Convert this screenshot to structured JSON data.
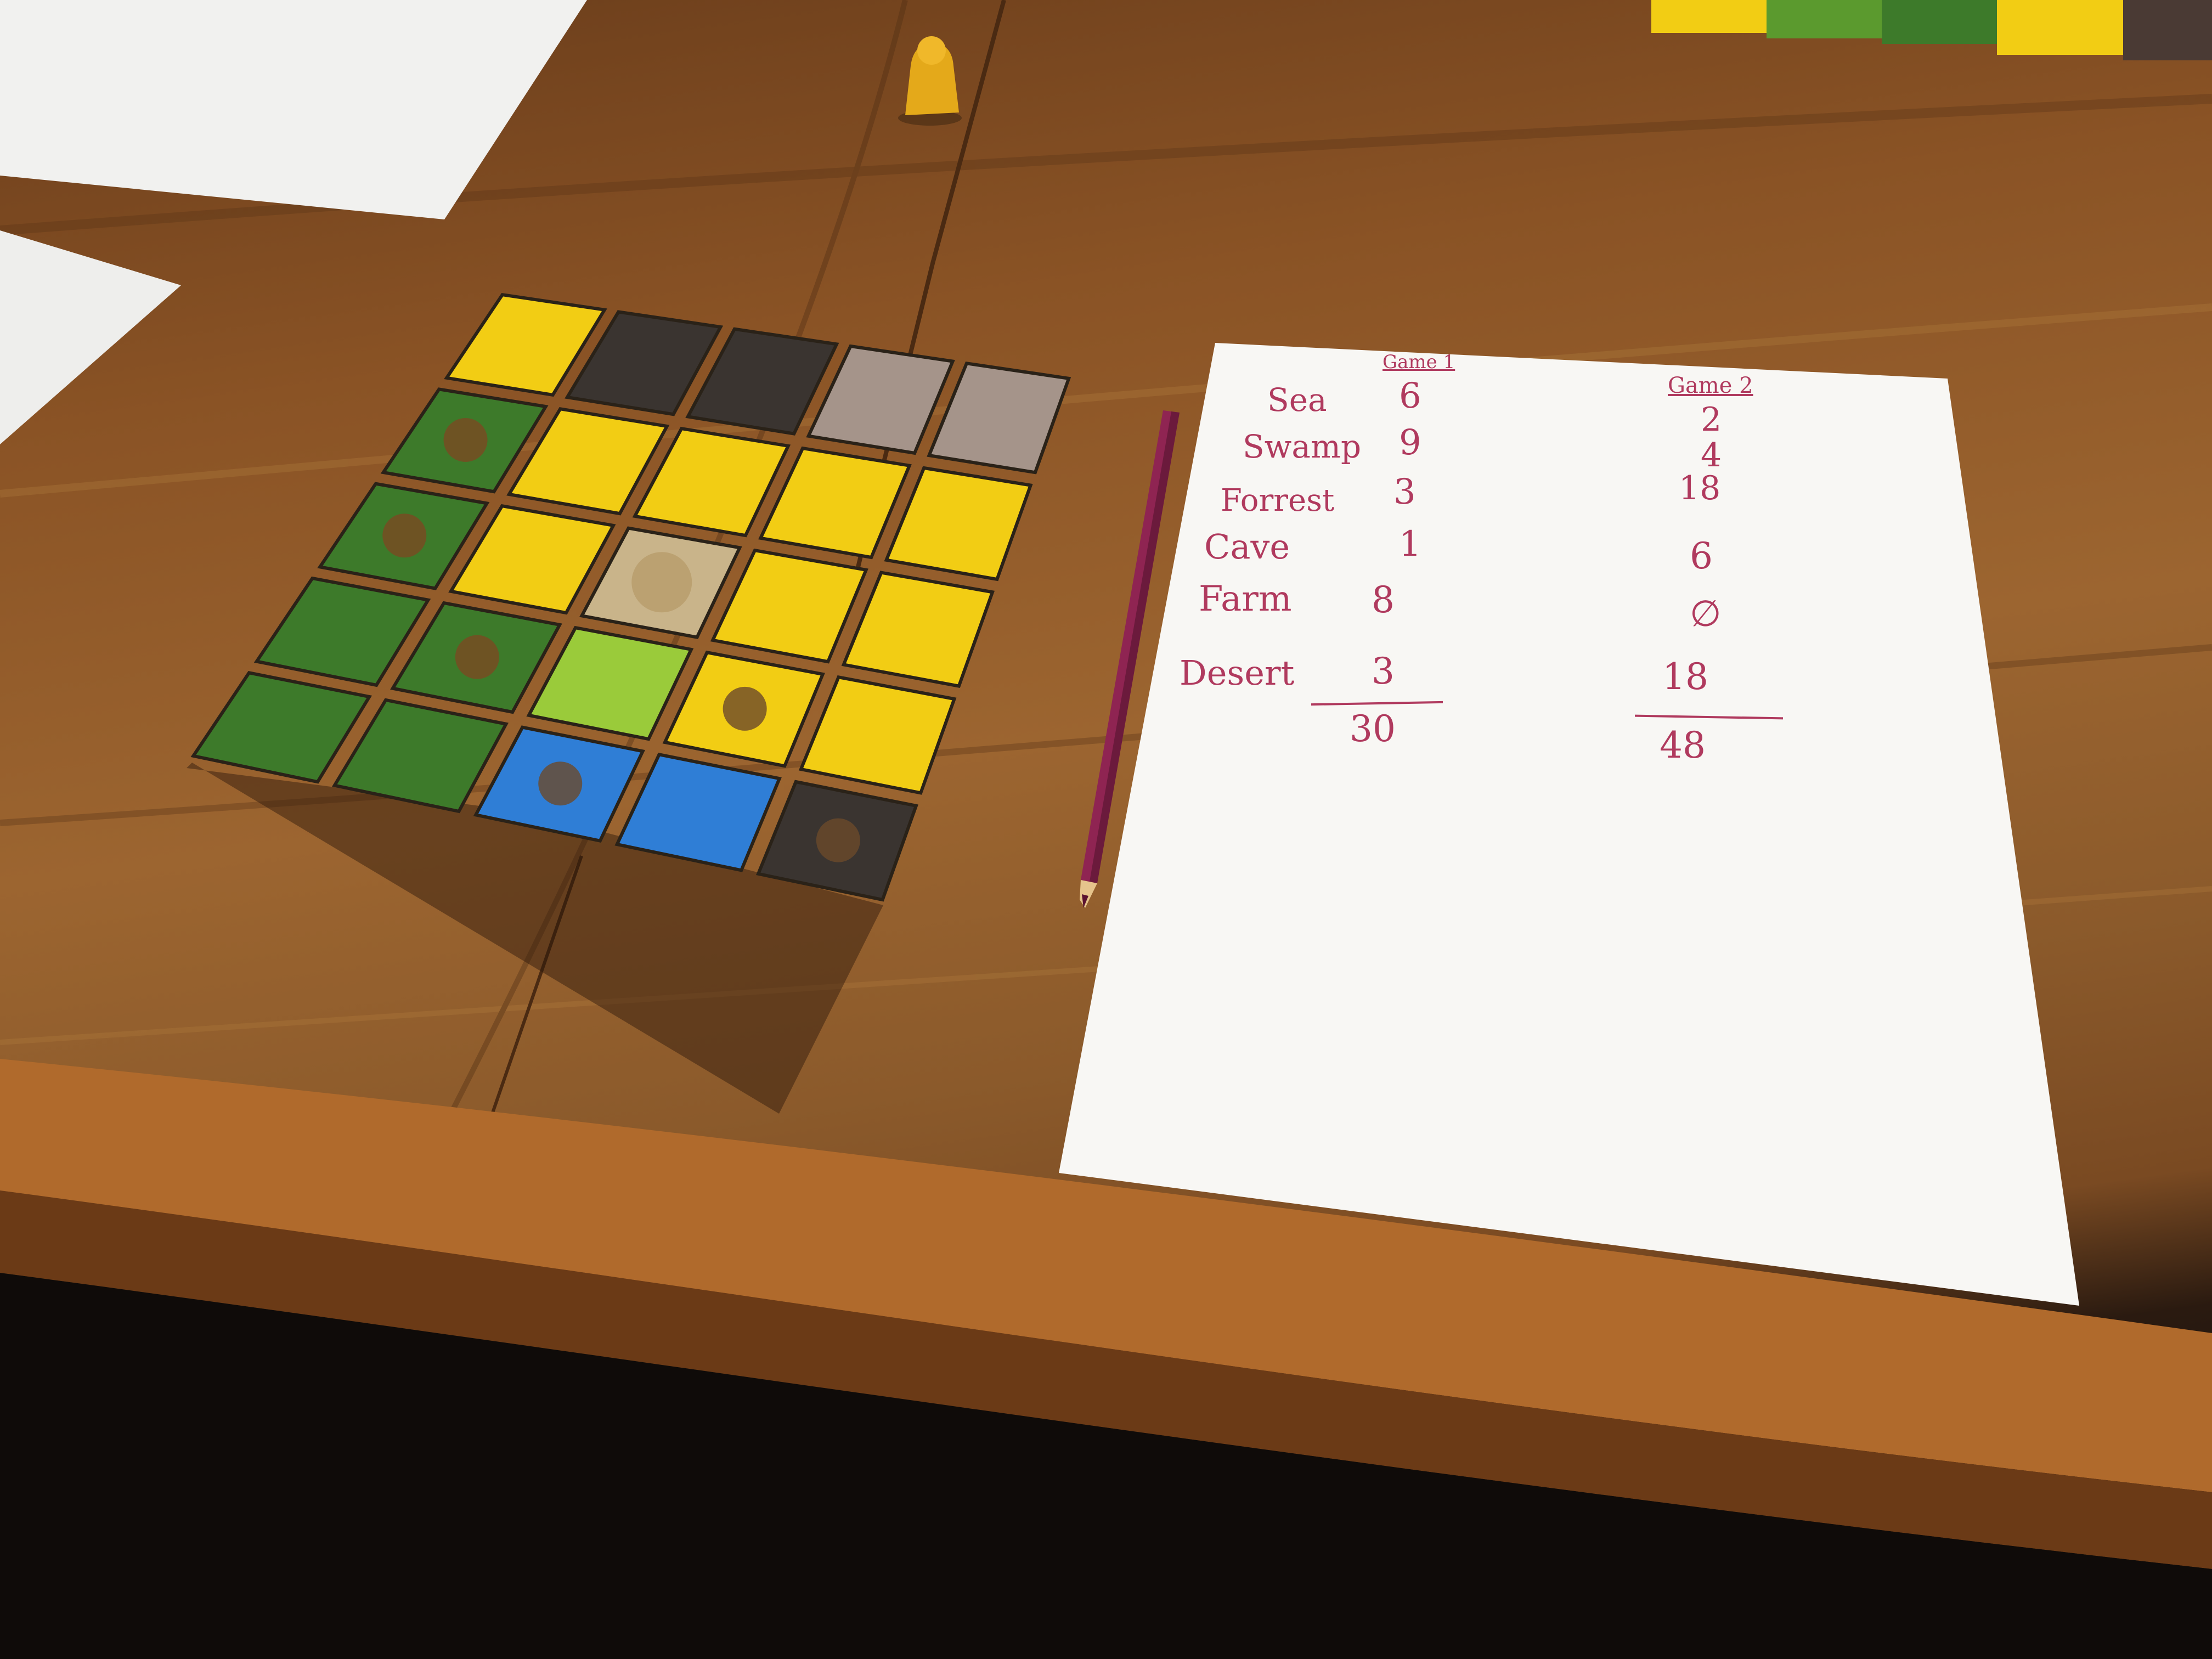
{
  "score_sheet": {
    "game_headers": [
      "Game 1",
      "Game 2"
    ],
    "rows": [
      {
        "label": "Sea",
        "game1": "6",
        "game2": "2"
      },
      {
        "label": "Swamp",
        "game1": "9",
        "game2": "4"
      },
      {
        "label": "Forrest",
        "game1": "3",
        "game2": "18"
      },
      {
        "label": "Cave",
        "game1": "1",
        "game2": "6"
      },
      {
        "label": "Farm",
        "game1": "8",
        "game2": "∅"
      },
      {
        "label": "Desert",
        "game1": "3",
        "game2": "18"
      }
    ],
    "totals": {
      "game1": "30",
      "game2": "48"
    }
  },
  "board": {
    "grid": [
      [
        "wheat",
        "cave",
        "cave",
        "swamp",
        "swamp"
      ],
      [
        "forest-house",
        "wheat",
        "wheat",
        "wheat",
        "wheat"
      ],
      [
        "forest-house",
        "wheat",
        "castle",
        "wheat",
        "wheat"
      ],
      [
        "forest",
        "forest-house",
        "grass",
        "wheat-mill",
        "wheat"
      ],
      [
        "forest",
        "forest",
        "sea-ship",
        "sea",
        "cave-rock"
      ]
    ],
    "colors": {
      "wheat": "#f2cd14",
      "cave": "#3a3430",
      "swamp": "#a5948a",
      "forest": "#3d7a2a",
      "grass": "#9acb3a",
      "sea": "#2f7ed6",
      "castle": "#c9b48a"
    }
  },
  "colors": {
    "table": "#8b5a2b",
    "paper": "#f8f7f4",
    "ink": "#b03a5e",
    "pencil": "#8f2452"
  }
}
